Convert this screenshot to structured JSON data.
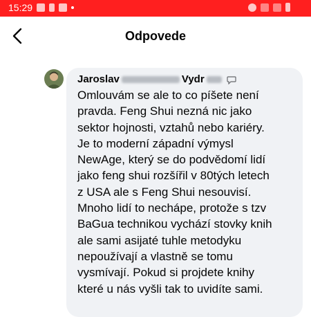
{
  "status_bar": {
    "time": "15:29",
    "background": "#ff1f1f",
    "icons": [
      "gallery-icon",
      "download-icon",
      "app-icon",
      "dot-icon",
      "alarm-icon",
      "wifi-icon",
      "signal-icon",
      "battery-icon"
    ]
  },
  "header": {
    "title": "Odpovede",
    "back_icon": "back-arrow-icon"
  },
  "comment": {
    "author_first": "Jaroslav",
    "author_part": "Vydr",
    "author_badge_icon": "chat-bubble-icon",
    "avatar_icon": "avatar",
    "bubble_color": "#f0f2f5",
    "lines": [
      "Omlouvám se ale to co píšete není",
      "pravda. Feng Shui nezná nic jako",
      "sektor hojnosti, vztahů nebo kariéry.",
      "Je to moderní západní výmysl",
      "NewAge, který se do podvědomí lidí",
      "jako feng shui rozšířil v 80tých letech",
      "z USA ale s Feng Shui nesouvisí.",
      "Mnoho lidí to nechápe, protože s tzv",
      "BaGua technikou vychází stovky knih",
      "ale sami asijaté tuhle metodyku",
      "nepoužívají a vlastně se tomu",
      "vysmívají. Pokud si projdete knihy",
      "které u nás vyšli tak to uvidíte sami."
    ]
  }
}
